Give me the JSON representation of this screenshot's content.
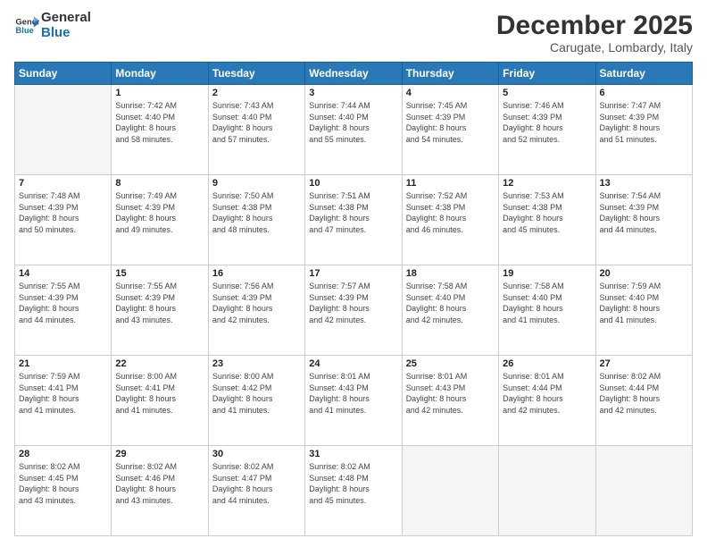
{
  "header": {
    "logo_line1": "General",
    "logo_line2": "Blue",
    "month": "December 2025",
    "location": "Carugate, Lombardy, Italy"
  },
  "days_header": [
    "Sunday",
    "Monday",
    "Tuesday",
    "Wednesday",
    "Thursday",
    "Friday",
    "Saturday"
  ],
  "weeks": [
    [
      {
        "day": "",
        "text": ""
      },
      {
        "day": "1",
        "text": "Sunrise: 7:42 AM\nSunset: 4:40 PM\nDaylight: 8 hours\nand 58 minutes."
      },
      {
        "day": "2",
        "text": "Sunrise: 7:43 AM\nSunset: 4:40 PM\nDaylight: 8 hours\nand 57 minutes."
      },
      {
        "day": "3",
        "text": "Sunrise: 7:44 AM\nSunset: 4:40 PM\nDaylight: 8 hours\nand 55 minutes."
      },
      {
        "day": "4",
        "text": "Sunrise: 7:45 AM\nSunset: 4:39 PM\nDaylight: 8 hours\nand 54 minutes."
      },
      {
        "day": "5",
        "text": "Sunrise: 7:46 AM\nSunset: 4:39 PM\nDaylight: 8 hours\nand 52 minutes."
      },
      {
        "day": "6",
        "text": "Sunrise: 7:47 AM\nSunset: 4:39 PM\nDaylight: 8 hours\nand 51 minutes."
      }
    ],
    [
      {
        "day": "7",
        "text": "Sunrise: 7:48 AM\nSunset: 4:39 PM\nDaylight: 8 hours\nand 50 minutes."
      },
      {
        "day": "8",
        "text": "Sunrise: 7:49 AM\nSunset: 4:39 PM\nDaylight: 8 hours\nand 49 minutes."
      },
      {
        "day": "9",
        "text": "Sunrise: 7:50 AM\nSunset: 4:38 PM\nDaylight: 8 hours\nand 48 minutes."
      },
      {
        "day": "10",
        "text": "Sunrise: 7:51 AM\nSunset: 4:38 PM\nDaylight: 8 hours\nand 47 minutes."
      },
      {
        "day": "11",
        "text": "Sunrise: 7:52 AM\nSunset: 4:38 PM\nDaylight: 8 hours\nand 46 minutes."
      },
      {
        "day": "12",
        "text": "Sunrise: 7:53 AM\nSunset: 4:38 PM\nDaylight: 8 hours\nand 45 minutes."
      },
      {
        "day": "13",
        "text": "Sunrise: 7:54 AM\nSunset: 4:39 PM\nDaylight: 8 hours\nand 44 minutes."
      }
    ],
    [
      {
        "day": "14",
        "text": "Sunrise: 7:55 AM\nSunset: 4:39 PM\nDaylight: 8 hours\nand 44 minutes."
      },
      {
        "day": "15",
        "text": "Sunrise: 7:55 AM\nSunset: 4:39 PM\nDaylight: 8 hours\nand 43 minutes."
      },
      {
        "day": "16",
        "text": "Sunrise: 7:56 AM\nSunset: 4:39 PM\nDaylight: 8 hours\nand 42 minutes."
      },
      {
        "day": "17",
        "text": "Sunrise: 7:57 AM\nSunset: 4:39 PM\nDaylight: 8 hours\nand 42 minutes."
      },
      {
        "day": "18",
        "text": "Sunrise: 7:58 AM\nSunset: 4:40 PM\nDaylight: 8 hours\nand 42 minutes."
      },
      {
        "day": "19",
        "text": "Sunrise: 7:58 AM\nSunset: 4:40 PM\nDaylight: 8 hours\nand 41 minutes."
      },
      {
        "day": "20",
        "text": "Sunrise: 7:59 AM\nSunset: 4:40 PM\nDaylight: 8 hours\nand 41 minutes."
      }
    ],
    [
      {
        "day": "21",
        "text": "Sunrise: 7:59 AM\nSunset: 4:41 PM\nDaylight: 8 hours\nand 41 minutes."
      },
      {
        "day": "22",
        "text": "Sunrise: 8:00 AM\nSunset: 4:41 PM\nDaylight: 8 hours\nand 41 minutes."
      },
      {
        "day": "23",
        "text": "Sunrise: 8:00 AM\nSunset: 4:42 PM\nDaylight: 8 hours\nand 41 minutes."
      },
      {
        "day": "24",
        "text": "Sunrise: 8:01 AM\nSunset: 4:43 PM\nDaylight: 8 hours\nand 41 minutes."
      },
      {
        "day": "25",
        "text": "Sunrise: 8:01 AM\nSunset: 4:43 PM\nDaylight: 8 hours\nand 42 minutes."
      },
      {
        "day": "26",
        "text": "Sunrise: 8:01 AM\nSunset: 4:44 PM\nDaylight: 8 hours\nand 42 minutes."
      },
      {
        "day": "27",
        "text": "Sunrise: 8:02 AM\nSunset: 4:44 PM\nDaylight: 8 hours\nand 42 minutes."
      }
    ],
    [
      {
        "day": "28",
        "text": "Sunrise: 8:02 AM\nSunset: 4:45 PM\nDaylight: 8 hours\nand 43 minutes."
      },
      {
        "day": "29",
        "text": "Sunrise: 8:02 AM\nSunset: 4:46 PM\nDaylight: 8 hours\nand 43 minutes."
      },
      {
        "day": "30",
        "text": "Sunrise: 8:02 AM\nSunset: 4:47 PM\nDaylight: 8 hours\nand 44 minutes."
      },
      {
        "day": "31",
        "text": "Sunrise: 8:02 AM\nSunset: 4:48 PM\nDaylight: 8 hours\nand 45 minutes."
      },
      {
        "day": "",
        "text": ""
      },
      {
        "day": "",
        "text": ""
      },
      {
        "day": "",
        "text": ""
      }
    ]
  ]
}
